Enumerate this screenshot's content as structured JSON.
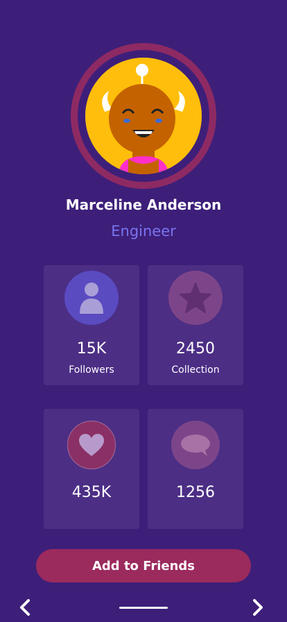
{
  "profile": {
    "name": "Marceline Anderson",
    "role": "Engineer"
  },
  "stats": [
    {
      "value": "15K",
      "label": "Followers",
      "icon": "user-icon"
    },
    {
      "value": "2450",
      "label": "Collection",
      "icon": "star-icon"
    },
    {
      "value": "435K",
      "label": "",
      "icon": "heart-icon"
    },
    {
      "value": "1256",
      "label": "",
      "icon": "chat-icon"
    }
  ],
  "actions": {
    "add_friends_label": "Add to Friends"
  },
  "nav": {
    "back_icon": "chevron-left-icon",
    "forward_icon": "chevron-right-icon"
  },
  "colors": {
    "background": "#3d1f79",
    "card": "#4c2e85",
    "accent": "#9b2a5d",
    "role_text": "#7b74f0"
  }
}
